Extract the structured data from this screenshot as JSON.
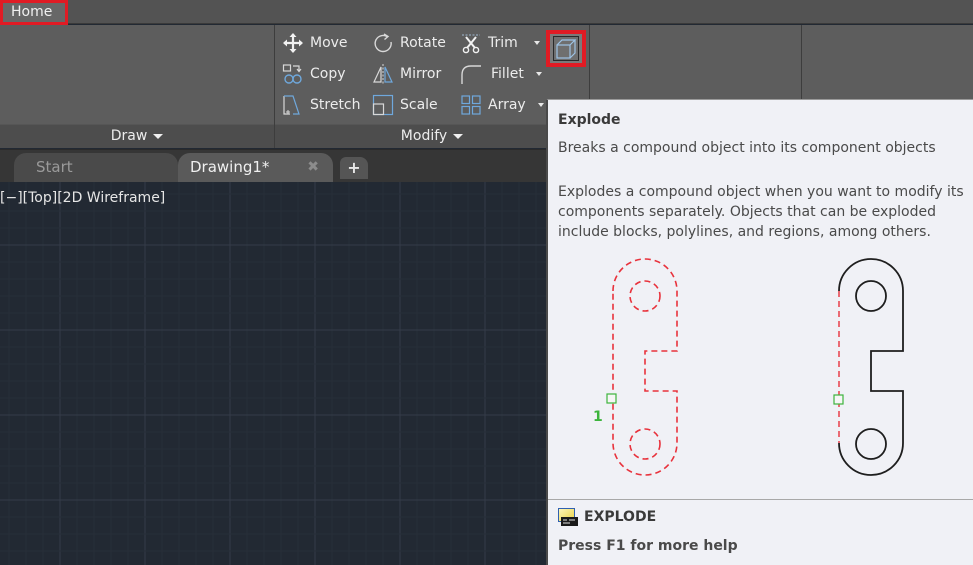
{
  "ribbon_tabs": {
    "active": "Home"
  },
  "ribbon": {
    "panels": [
      {
        "name": "draw",
        "label": "Draw"
      },
      {
        "name": "modify",
        "label": "Modify"
      }
    ],
    "modify_commands": {
      "move": "Move",
      "rotate": "Rotate",
      "trim": "Trim",
      "copy": "Copy",
      "mirror": "Mirror",
      "fillet": "Fillet",
      "stretch": "Stretch",
      "scale": "Scale",
      "array": "Array"
    },
    "highlighted_tool": "explode-icon"
  },
  "document_tabs": [
    {
      "label": "Start",
      "active": false
    },
    {
      "label": "Drawing1*",
      "active": true,
      "close": "✖"
    }
  ],
  "new_tab": "+",
  "viewport": {
    "label": "[−][Top][2D Wireframe]"
  },
  "tooltip": {
    "title": "Explode",
    "short_description": "Breaks a compound object into its component objects",
    "long_description": "Explodes a compound object when you want to modify its components separately. Objects that can be exploded include blocks, polylines, and regions, among others.",
    "illustration_label": "1",
    "command_name": "EXPLODE",
    "help_text": "Press F1 for more help"
  },
  "colors": {
    "highlight": "#e01b24",
    "viewport_bg": "#222933",
    "ribbon_bg": "#5d5d5d",
    "tooltip_bg": "#f0f1f6",
    "dashed_red": "#e8323c",
    "grip_green": "#3cb43c"
  }
}
